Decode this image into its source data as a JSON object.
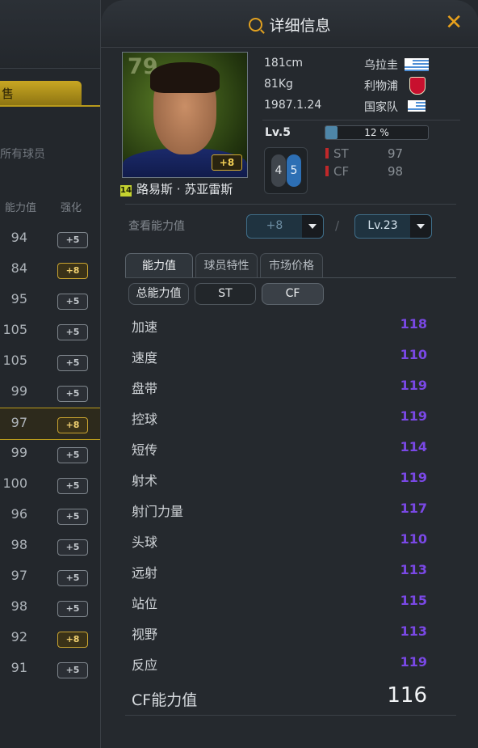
{
  "left_panel": {
    "sell_tab": "售",
    "all_players": "所有球员",
    "col_ability": "能力值",
    "col_enhance": "强化",
    "rows": [
      {
        "value": "94",
        "badge": "+5",
        "gold": false
      },
      {
        "value": "84",
        "badge": "+8",
        "gold": true
      },
      {
        "value": "95",
        "badge": "+5",
        "gold": false
      },
      {
        "value": "105",
        "badge": "+5",
        "gold": false
      },
      {
        "value": "105",
        "badge": "+5",
        "gold": false
      },
      {
        "value": "99",
        "badge": "+5",
        "gold": false
      },
      {
        "value": "97",
        "badge": "+8",
        "gold": true,
        "selected": true
      },
      {
        "value": "99",
        "badge": "+5",
        "gold": false
      },
      {
        "value": "100",
        "badge": "+5",
        "gold": false
      },
      {
        "value": "96",
        "badge": "+5",
        "gold": false
      },
      {
        "value": "98",
        "badge": "+5",
        "gold": false
      },
      {
        "value": "97",
        "badge": "+5",
        "gold": false
      },
      {
        "value": "98",
        "badge": "+5",
        "gold": false
      },
      {
        "value": "92",
        "badge": "+8",
        "gold": true
      },
      {
        "value": "91",
        "badge": "+5",
        "gold": false
      }
    ]
  },
  "dialog": {
    "title": "详细信息",
    "close": "✕"
  },
  "player": {
    "overall": "79",
    "enhance_badge": "+8",
    "season_tag": "14",
    "name": "路易斯 · 苏亚雷斯",
    "height": "181cm",
    "weight": "81Kg",
    "birthday": "1987.1.24",
    "nation": "乌拉圭",
    "club": "利物浦",
    "national_team": "国家队",
    "level": "Lv.5",
    "exp_percent_text": "12 %",
    "exp_fraction": 0.12,
    "pos_pill_a": "4",
    "pos_pill_b": "5",
    "positions": [
      {
        "pos": "ST",
        "value": "97"
      },
      {
        "pos": "CF",
        "value": "98"
      }
    ]
  },
  "view": {
    "label": "查看能力值",
    "enhance_select": "+8",
    "level_select": "Lv.23",
    "slash": "/"
  },
  "tabs": [
    "能力值",
    "球员特性",
    "市场价格"
  ],
  "sub_tabs": [
    "总能力值",
    "ST",
    "CF"
  ],
  "stats": [
    {
      "name": "加速",
      "value": "118"
    },
    {
      "name": "速度",
      "value": "110"
    },
    {
      "name": "盘带",
      "value": "119"
    },
    {
      "name": "控球",
      "value": "119"
    },
    {
      "name": "短传",
      "value": "114"
    },
    {
      "name": "射术",
      "value": "119"
    },
    {
      "name": "射门力量",
      "value": "117"
    },
    {
      "name": "头球",
      "value": "110"
    },
    {
      "name": "远射",
      "value": "113"
    },
    {
      "name": "站位",
      "value": "115"
    },
    {
      "name": "视野",
      "value": "113"
    },
    {
      "name": "反应",
      "value": "119"
    }
  ],
  "total": {
    "label": "CF能力值",
    "value": "116"
  },
  "colors": {
    "accent": "#e8a11c",
    "stat_value": "#7a48e6",
    "gold": "#c9a723"
  }
}
